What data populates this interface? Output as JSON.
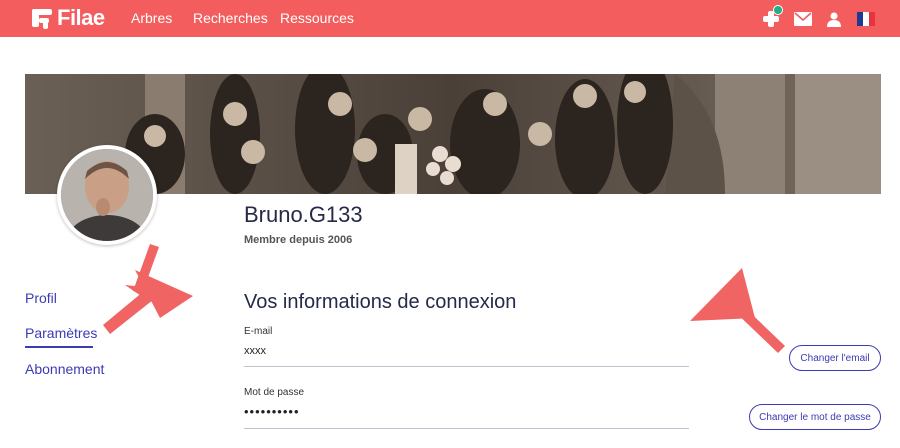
{
  "brand": {
    "name": "Filae",
    "accent": "#f35d5d",
    "link_color": "#3b3bb3",
    "notif_color": "#1fae86"
  },
  "nav": {
    "items": [
      "Arbres",
      "Recherches",
      "Ressources"
    ]
  },
  "header_icons": [
    "add-person-icon",
    "mail-icon",
    "user-icon",
    "flag-france-icon"
  ],
  "profile": {
    "username": "Bruno.G133",
    "member_since": "Membre depuis 2006"
  },
  "sidebar": {
    "items": [
      {
        "label": "Profil"
      },
      {
        "label": "Paramètres",
        "active": true
      },
      {
        "label": "Abonnement"
      }
    ]
  },
  "login_section": {
    "title": "Vos informations de connexion",
    "email": {
      "label": "E-mail",
      "value": "xxxx",
      "button": "Changer l'email"
    },
    "password": {
      "label": "Mot de passe",
      "value": "••••••••••",
      "button": "Changer le mot de passe"
    }
  }
}
